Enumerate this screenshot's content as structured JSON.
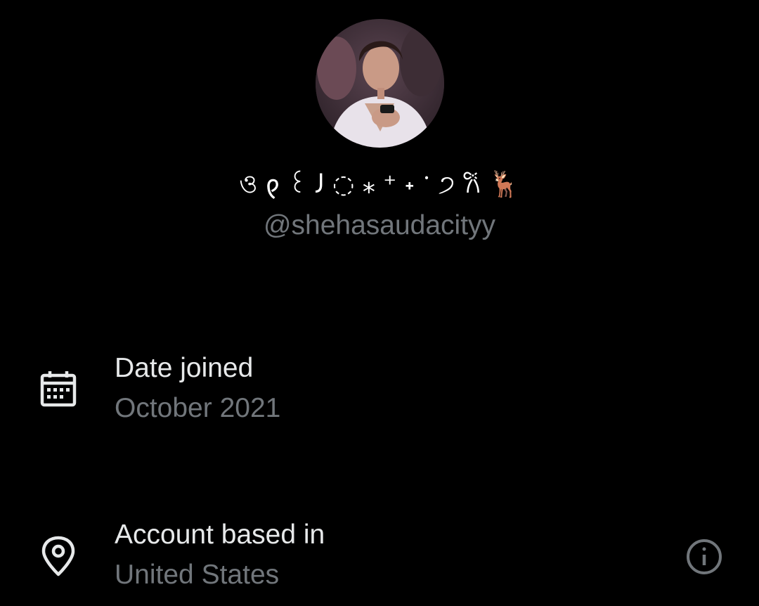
{
  "profile": {
    "display_name": "ও 𐑞 ꒰ 𐑓 ◌ ⁎ ⁺ ˖ ॱ ੭ 𐙚 🦌",
    "handle": "@shehasaudacityy",
    "avatar_alt": "profile photo"
  },
  "details": {
    "date_joined": {
      "title": "Date joined",
      "value": "October 2021",
      "icon": "calendar-icon"
    },
    "account_based_in": {
      "title": "Account based in",
      "value": "United States",
      "icon": "location-pin-icon",
      "info_icon": "info-icon"
    }
  },
  "colors": {
    "background": "#000000",
    "primary_text": "#e7e9ea",
    "secondary_text": "#71767b",
    "icon": "#e7e9ea"
  }
}
